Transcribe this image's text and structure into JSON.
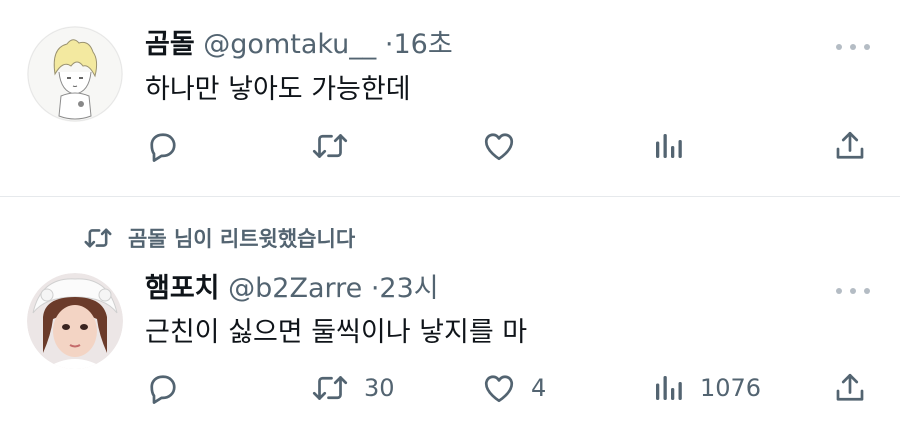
{
  "tweets": [
    {
      "author_name": "곰돌",
      "handle": "@gomtaku__",
      "separator": "·",
      "time": "16초",
      "text": "하나만 낳아도 가능한데",
      "reply_count": "",
      "retweet_count": "",
      "like_count": "",
      "view_count": ""
    },
    {
      "retweeted_by": "곰돌 님이 리트윗했습니다",
      "author_name": "햄포치",
      "handle": "@b2Zarre",
      "separator": "·",
      "time": "23시",
      "text": "근친이 싫으면 둘씩이나 낳지를 마",
      "reply_count": "",
      "retweet_count": "30",
      "like_count": "4",
      "view_count": "1076"
    }
  ],
  "icons": {
    "reply": "reply-icon",
    "retweet": "retweet-icon",
    "like": "heart-icon",
    "views": "views-icon",
    "share": "share-icon",
    "more": "more-icon"
  },
  "colors": {
    "icon": "#536471",
    "text": "#0f1419",
    "divider": "#e6e9ec"
  }
}
